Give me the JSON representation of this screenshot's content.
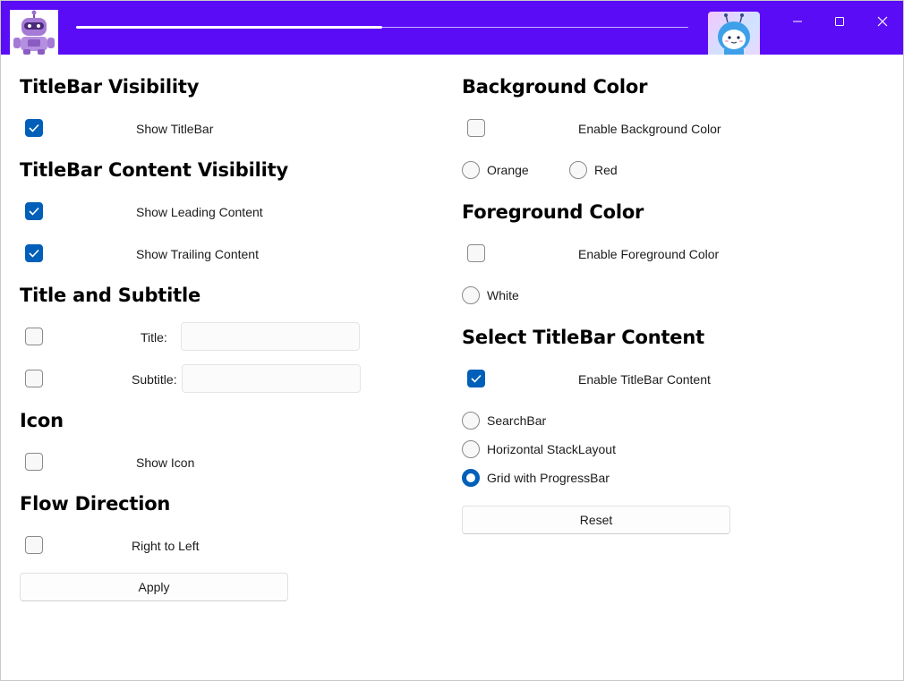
{
  "titlebar": {
    "app_icon": "robot-mascot",
    "progress_percent": 50,
    "avatar": "blue-character-avatar",
    "caption_buttons": [
      "minimize",
      "maximize",
      "close"
    ]
  },
  "left": {
    "titlebar_visibility": {
      "heading": "TitleBar Visibility",
      "show_titlebar_label": "Show TitleBar",
      "show_titlebar_checked": true
    },
    "content_visibility": {
      "heading": "TitleBar Content Visibility",
      "show_leading_label": "Show Leading Content",
      "show_leading_checked": true,
      "show_trailing_label": "Show Trailing Content",
      "show_trailing_checked": true
    },
    "title_subtitle": {
      "heading": "Title and Subtitle",
      "title_label": "Title:",
      "title_value": "",
      "title_checked": false,
      "subtitle_label": "Subtitle:",
      "subtitle_value": "",
      "subtitle_checked": false
    },
    "icon": {
      "heading": "Icon",
      "show_icon_label": "Show Icon",
      "show_icon_checked": false
    },
    "flow_direction": {
      "heading": "Flow Direction",
      "rtl_label": "Right to Left",
      "rtl_checked": false
    },
    "apply_label": "Apply"
  },
  "right": {
    "background_color": {
      "heading": "Background Color",
      "enable_label": "Enable Background Color",
      "enable_checked": false,
      "options": [
        "Orange",
        "Red"
      ]
    },
    "foreground_color": {
      "heading": "Foreground Color",
      "enable_label": "Enable Foreground Color",
      "enable_checked": false,
      "options": [
        "White"
      ]
    },
    "titlebar_content": {
      "heading": "Select TitleBar Content",
      "enable_label": "Enable TitleBar Content",
      "enable_checked": true,
      "options": [
        "SearchBar",
        "Horizontal StackLayout",
        "Grid with ProgressBar"
      ],
      "selected": "Grid with ProgressBar"
    },
    "reset_label": "Reset"
  },
  "colors": {
    "titlebar_bg": "#5b0cf7",
    "accent": "#005fb8"
  }
}
